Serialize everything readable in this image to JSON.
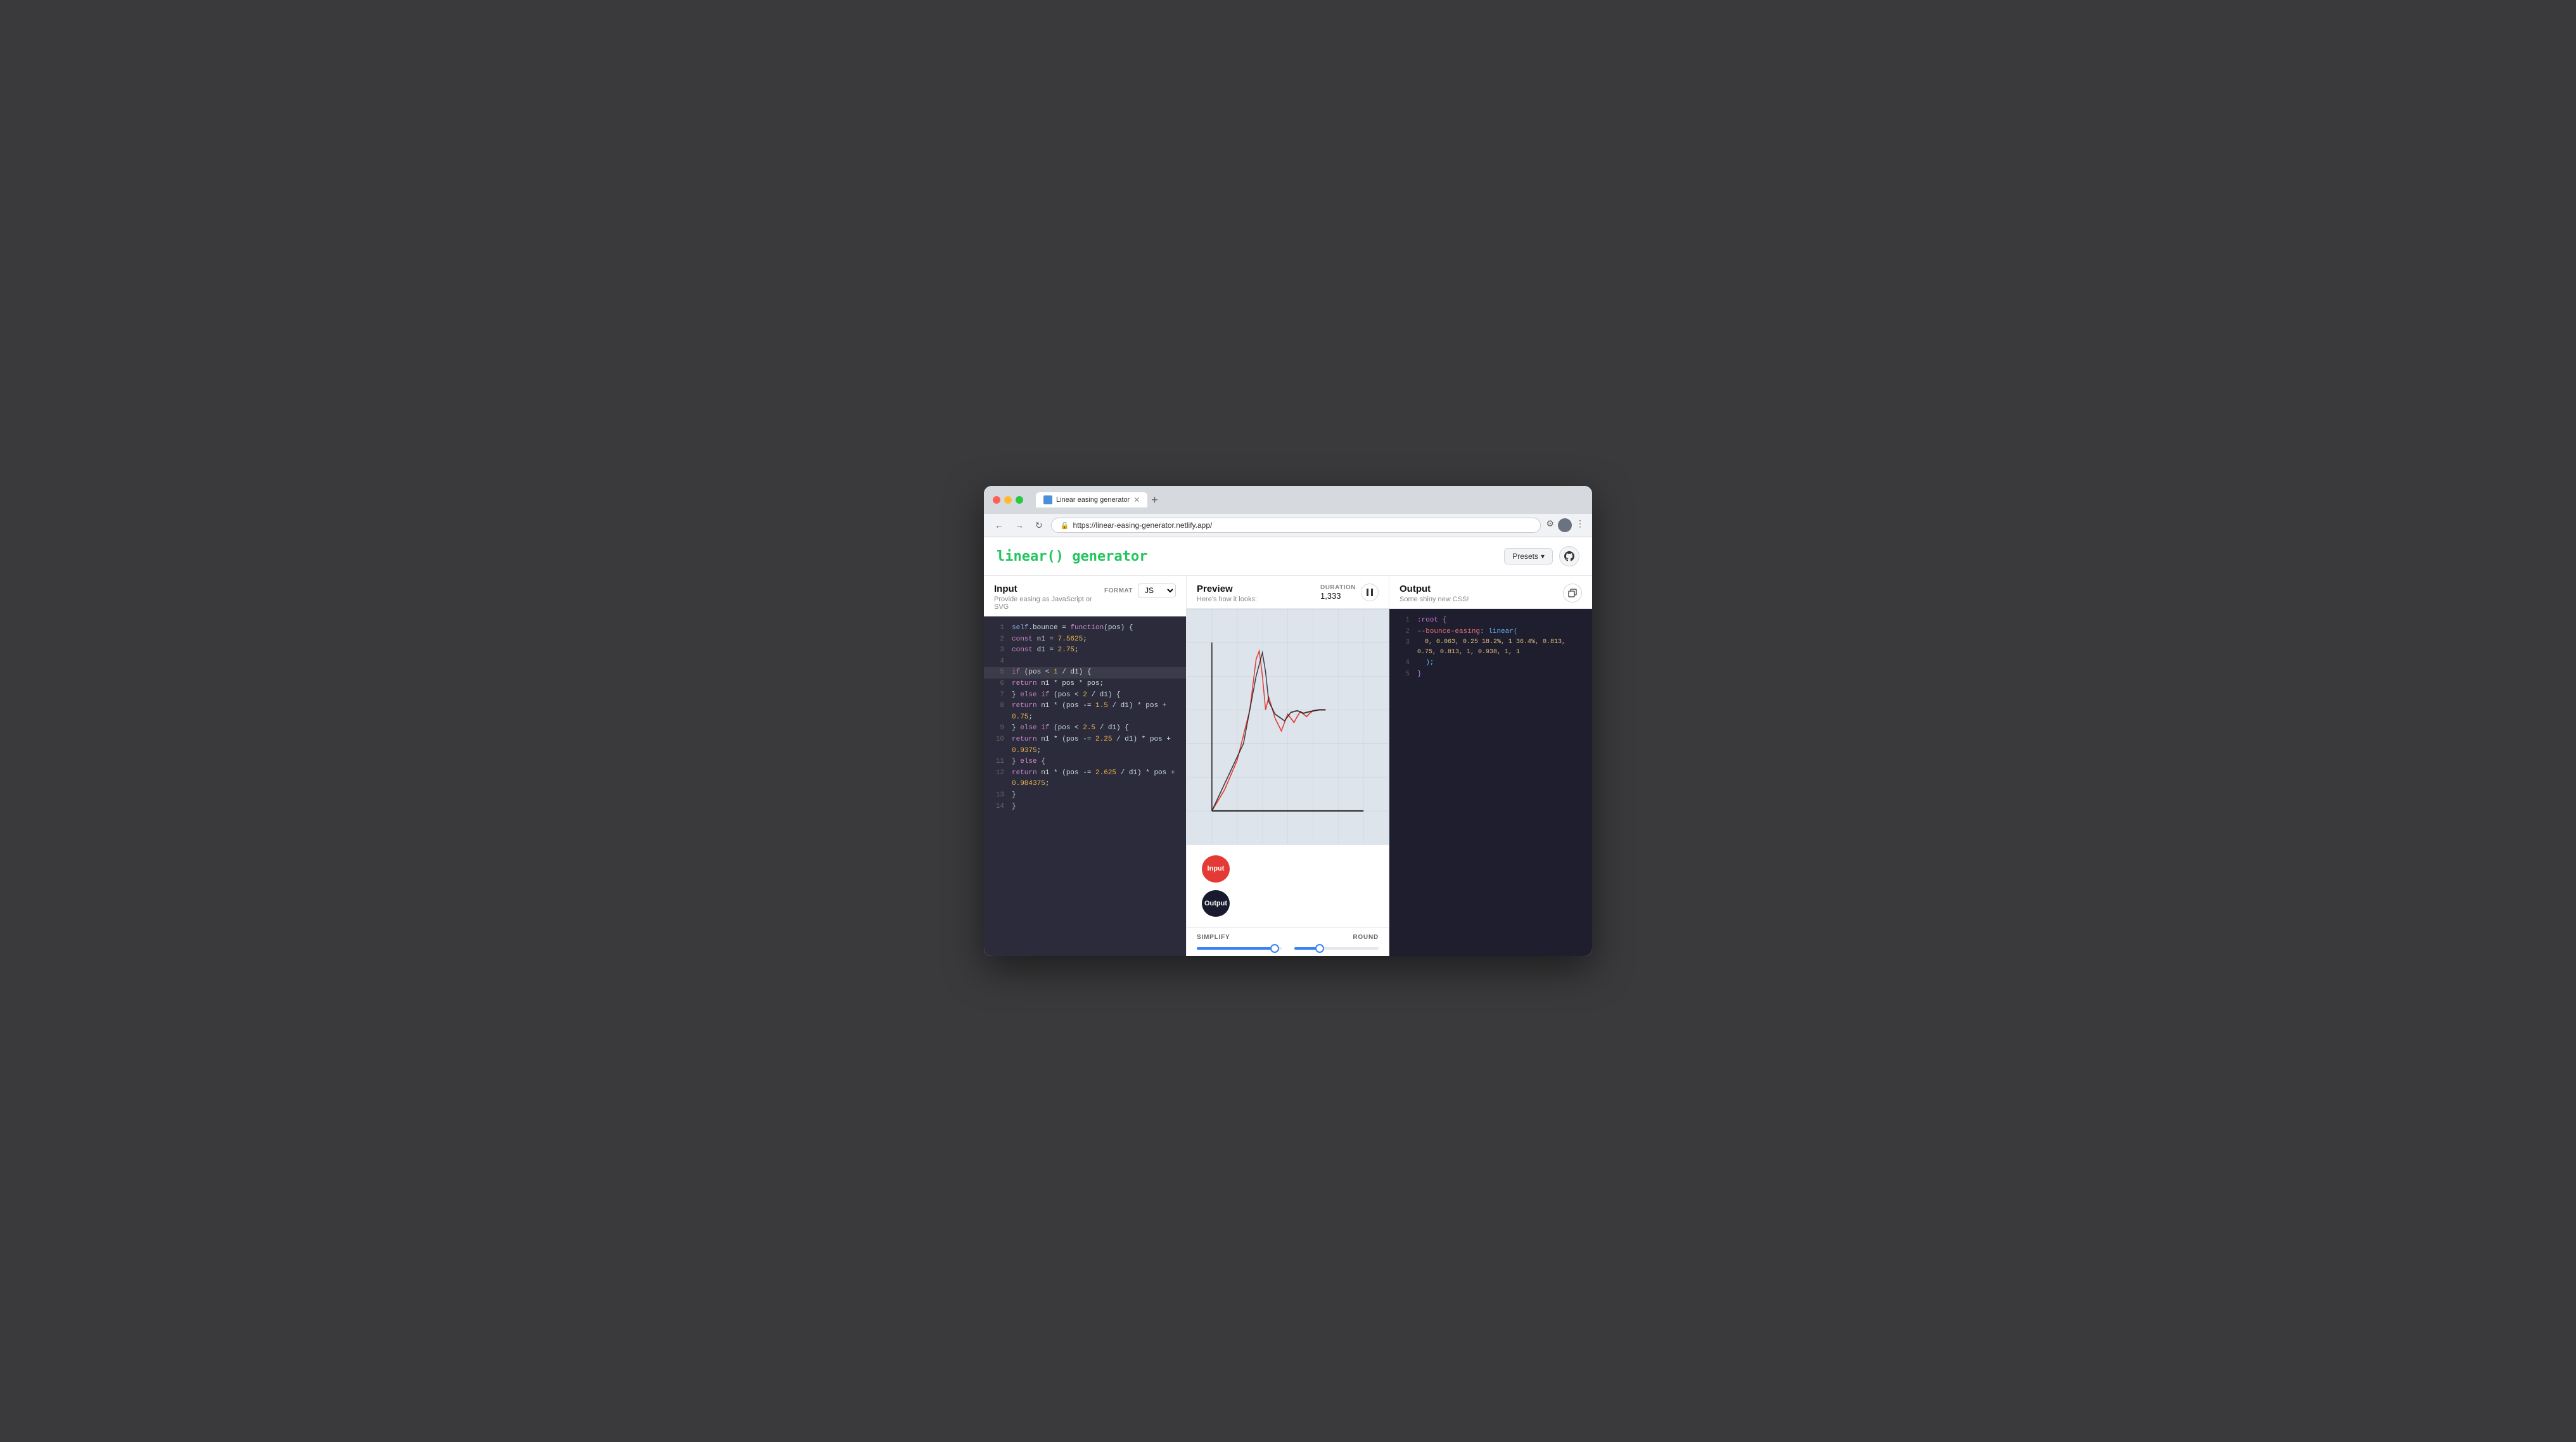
{
  "browser": {
    "tab_title": "Linear easing generator",
    "url": "https://linear-easing-generator.netlify.app/",
    "new_tab_label": "+"
  },
  "header": {
    "logo": "linear() generator",
    "presets_label": "Presets",
    "github_icon": "github-icon"
  },
  "input_panel": {
    "title": "Input",
    "subtitle": "Provide easing as JavaScript or SVG",
    "format_label": "FORMAT",
    "format_value": "JS",
    "code_lines": [
      {
        "num": 1,
        "text": "self.bounce = function(pos) {",
        "highlight": false
      },
      {
        "num": 2,
        "text": "  const n1 = 7.5625;",
        "highlight": false
      },
      {
        "num": 3,
        "text": "  const d1 = 2.75;",
        "highlight": false
      },
      {
        "num": 4,
        "text": "",
        "highlight": false
      },
      {
        "num": 5,
        "text": "  if (pos < 1 / d1) {",
        "highlight": true
      },
      {
        "num": 6,
        "text": "    return n1 * pos * pos;",
        "highlight": false
      },
      {
        "num": 7,
        "text": "  } else if (pos < 2 / d1) {",
        "highlight": false
      },
      {
        "num": 8,
        "text": "    return n1 * (pos -= 1.5 / d1) * pos + 0.75;",
        "highlight": false
      },
      {
        "num": 9,
        "text": "  } else if (pos < 2.5 / d1) {",
        "highlight": false
      },
      {
        "num": 10,
        "text": "    return n1 * (pos -= 2.25 / d1) * pos + 0.9375;",
        "highlight": false
      },
      {
        "num": 11,
        "text": "  } else {",
        "highlight": false
      },
      {
        "num": 12,
        "text": "    return n1 * (pos -= 2.625 / d1) * pos + 0.984375;",
        "highlight": false
      },
      {
        "num": 13,
        "text": "  }",
        "highlight": false
      },
      {
        "num": 14,
        "text": "}",
        "highlight": false
      }
    ]
  },
  "preview_panel": {
    "title": "Preview",
    "subtitle": "Here's how it looks:",
    "duration_label": "DURATION",
    "duration_value": "1,333",
    "play_icon": "pause-icon",
    "animation_balls": [
      {
        "label": "Input",
        "color": "#e53935"
      },
      {
        "label": "Output",
        "color": "#1a1a2e"
      }
    ],
    "simplify_label": "SIMPLIFY",
    "simplify_fill_pct": 92,
    "round_label": "ROUND",
    "round_fill_pct": 30
  },
  "output_panel": {
    "title": "Output",
    "subtitle": "Some shiny new CSS!",
    "copy_icon": "copy-icon",
    "code_lines": [
      {
        "num": 1,
        "text": ":root {"
      },
      {
        "num": 2,
        "text": "  --bounce-easing: linear("
      },
      {
        "num": 3,
        "text": "    0, 0.063, 0.25 18.2%, 1 36.4%, 0.813, 0.75, 0.813, 1, 0.938, 1, 1"
      },
      {
        "num": 4,
        "text": "  );"
      },
      {
        "num": 5,
        "text": "}"
      }
    ]
  }
}
